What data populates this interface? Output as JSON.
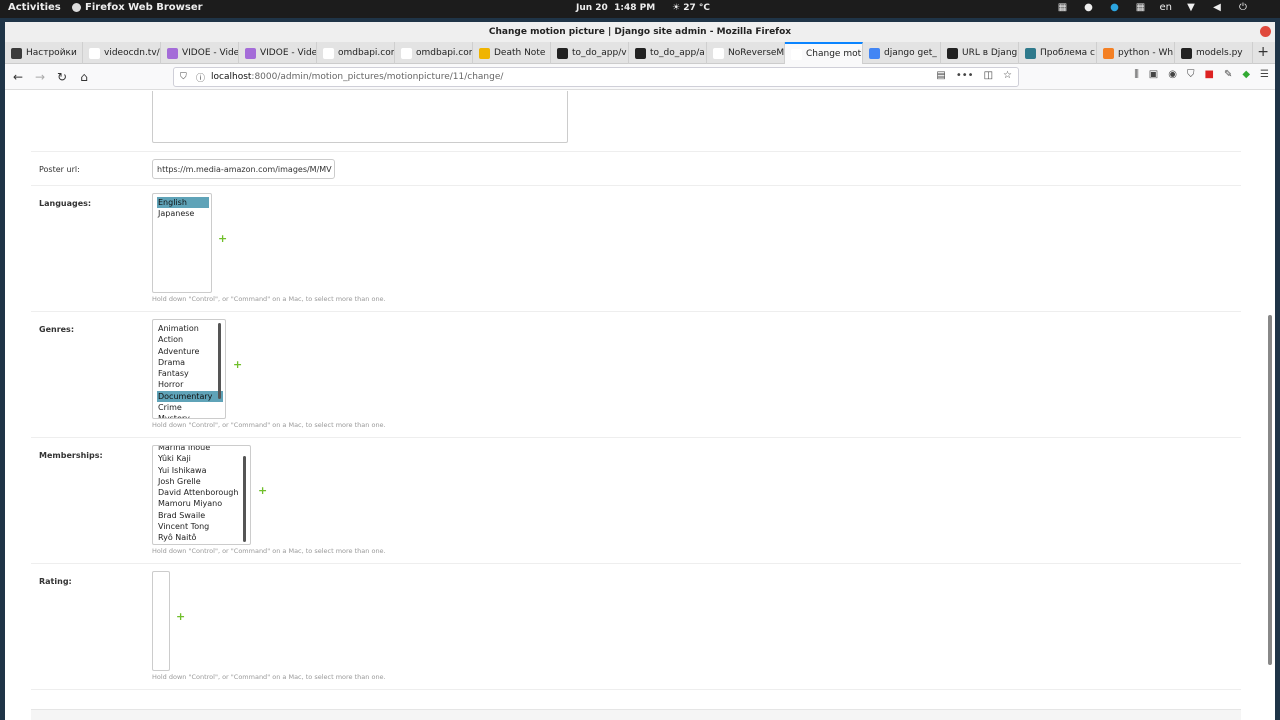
{
  "system": {
    "activities": "Activities",
    "app_name": "Firefox Web Browser",
    "date": "Jun 20",
    "time": "1:48 PM",
    "weather": "27 °C",
    "keyboard": "en"
  },
  "window": {
    "title": "Change motion picture | Django site admin - Mozilla Firefox"
  },
  "tabs": [
    {
      "label": "Настройки",
      "color": "#3b3b3b"
    },
    {
      "label": "videocdn.tv/api",
      "color": "#ffffff"
    },
    {
      "label": "VIDOE - Vide",
      "color": "#a46cd8"
    },
    {
      "label": "VIDOE - Vide",
      "color": "#a46cd8"
    },
    {
      "label": "omdbapi.com/?",
      "color": "#ffffff"
    },
    {
      "label": "omdbapi.com/?",
      "color": "#ffffff"
    },
    {
      "label": "Death Note",
      "color": "#f0b400"
    },
    {
      "label": "to_do_app/v",
      "color": "#222222"
    },
    {
      "label": "to_do_app/a",
      "color": "#222222"
    },
    {
      "label": "NoReverseMatc",
      "color": "#ffffff"
    },
    {
      "label": "Change motio",
      "color": "#ffffff",
      "active": true
    },
    {
      "label": "django get_",
      "color": "#4285f4"
    },
    {
      "label": "URL в Djang",
      "color": "#222222"
    },
    {
      "label": "Проблема с",
      "color": "#2f7a8c"
    },
    {
      "label": "python - Wh",
      "color": "#f48024"
    },
    {
      "label": "models.py",
      "color": "#222222"
    }
  ],
  "url": {
    "host": "localhost",
    "path": ":8000/admin/motion_pictures/motionpicture/11/change/"
  },
  "form": {
    "poster_url": {
      "label": "Poster url:",
      "value": "https://m.media-amazon.com/images/M/MV"
    },
    "languages": {
      "label": "Languages:",
      "options": [
        "English",
        "Japanese"
      ],
      "selected": "English"
    },
    "genres": {
      "label": "Genres:",
      "options": [
        "Animation",
        "Action",
        "Adventure",
        "Drama",
        "Fantasy",
        "Horror",
        "Documentary",
        "Crime",
        "Mystery"
      ],
      "selected": "Documentary"
    },
    "memberships": {
      "label": "Memberships:",
      "options": [
        "Marina Inoue",
        "Yûki Kaji",
        "Yui Ishikawa",
        "Josh Grelle",
        "David Attenborough",
        "Mamoru Miyano",
        "Brad Swaile",
        "Vincent Tong",
        "Ryô Naitô"
      ]
    },
    "rating": {
      "label": "Rating:"
    },
    "help_text": "Hold down \"Control\", or \"Command\" on a Mac, to select more than one.",
    "add_symbol": "+"
  },
  "colors": {
    "accent": "#0a84ff",
    "selection": "#5fa3b8",
    "add_green": "#70bf2b"
  }
}
